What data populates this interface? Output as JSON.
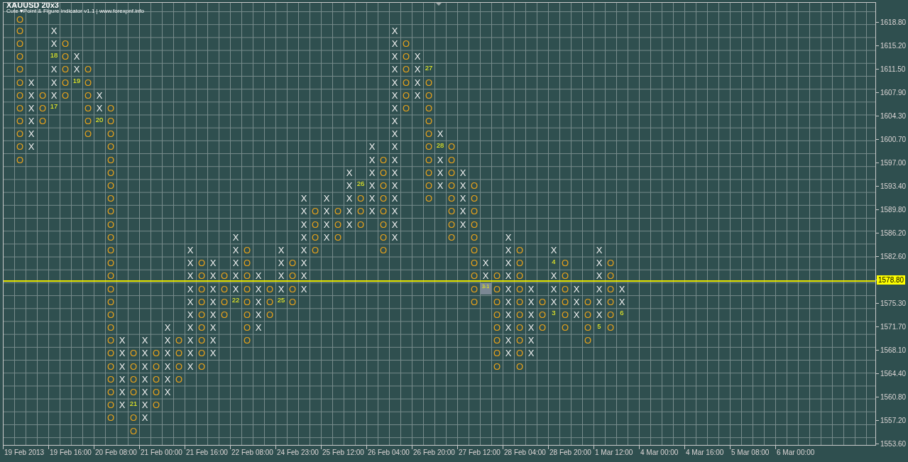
{
  "chart": {
    "title": "XAUUSD 20x3",
    "subtitle": "Cute ♥Point & Figure indicator v1.1 | www.forexpnf.info",
    "columns": [
      {
        "kind": "o",
        "cells": [
          "O",
          "O",
          "O",
          "O",
          "O",
          "O",
          "O",
          "O",
          "O",
          "O",
          "O",
          "O"
        ]
      },
      {
        "kind": "x",
        "cells": [
          null,
          null,
          null,
          null,
          null,
          "X",
          "X",
          "X",
          "X",
          "X",
          "X"
        ]
      },
      {
        "kind": "o",
        "cells": [
          null,
          null,
          null,
          null,
          null,
          null,
          "O",
          "O",
          "O"
        ]
      },
      {
        "kind": "x",
        "cells": [
          null,
          "X",
          "X",
          {
            "label": "18",
            "current": false
          },
          "X",
          "X",
          "X",
          {
            "label": "17",
            "current": false
          }
        ]
      },
      {
        "kind": "o",
        "cells": [
          null,
          null,
          "O",
          "O",
          "O",
          "O",
          "O"
        ]
      },
      {
        "kind": "x",
        "cells": [
          null,
          null,
          null,
          "X",
          "X",
          {
            "label": "19",
            "current": false
          }
        ]
      },
      {
        "kind": "o",
        "cells": [
          null,
          null,
          null,
          null,
          "O",
          "O",
          "O",
          "O",
          "O",
          "O"
        ]
      },
      {
        "kind": "x",
        "cells": [
          null,
          null,
          null,
          null,
          null,
          null,
          "X",
          "X",
          {
            "label": "20",
            "current": false
          }
        ]
      },
      {
        "kind": "o",
        "cells": [
          null,
          null,
          null,
          null,
          null,
          null,
          null,
          "O",
          "O",
          "O",
          "O",
          "O",
          "O",
          "O",
          "O",
          "O",
          "O",
          "O",
          "O",
          "O",
          "O",
          "O",
          "O",
          "O",
          "O",
          "O",
          "O",
          "O",
          "O",
          "O",
          "O",
          "O"
        ]
      },
      {
        "kind": "x",
        "cells": [
          null,
          null,
          null,
          null,
          null,
          null,
          null,
          null,
          null,
          null,
          null,
          null,
          null,
          null,
          null,
          null,
          null,
          null,
          null,
          null,
          null,
          null,
          null,
          null,
          null,
          "X",
          "X",
          "X",
          "X",
          "X",
          "X"
        ]
      },
      {
        "kind": "o",
        "cells": [
          null,
          null,
          null,
          null,
          null,
          null,
          null,
          null,
          null,
          null,
          null,
          null,
          null,
          null,
          null,
          null,
          null,
          null,
          null,
          null,
          null,
          null,
          null,
          null,
          null,
          null,
          "O",
          "O",
          "O",
          "O",
          {
            "label": "21",
            "current": false
          },
          "O",
          "O"
        ]
      },
      {
        "kind": "x",
        "cells": [
          null,
          null,
          null,
          null,
          null,
          null,
          null,
          null,
          null,
          null,
          null,
          null,
          null,
          null,
          null,
          null,
          null,
          null,
          null,
          null,
          null,
          null,
          null,
          null,
          null,
          "X",
          "X",
          "X",
          "X",
          "X",
          "X",
          "X"
        ]
      },
      {
        "kind": "o",
        "cells": [
          null,
          null,
          null,
          null,
          null,
          null,
          null,
          null,
          null,
          null,
          null,
          null,
          null,
          null,
          null,
          null,
          null,
          null,
          null,
          null,
          null,
          null,
          null,
          null,
          null,
          null,
          "O",
          "O",
          "O",
          "O",
          "O"
        ]
      },
      {
        "kind": "x",
        "cells": [
          null,
          null,
          null,
          null,
          null,
          null,
          null,
          null,
          null,
          null,
          null,
          null,
          null,
          null,
          null,
          null,
          null,
          null,
          null,
          null,
          null,
          null,
          null,
          null,
          "X",
          "X",
          "X",
          "X",
          "X",
          "X"
        ]
      },
      {
        "kind": "o",
        "cells": [
          null,
          null,
          null,
          null,
          null,
          null,
          null,
          null,
          null,
          null,
          null,
          null,
          null,
          null,
          null,
          null,
          null,
          null,
          null,
          null,
          null,
          null,
          null,
          null,
          null,
          "O",
          "O",
          "O",
          "O"
        ]
      },
      {
        "kind": "x",
        "cells": [
          null,
          null,
          null,
          null,
          null,
          null,
          null,
          null,
          null,
          null,
          null,
          null,
          null,
          null,
          null,
          null,
          null,
          null,
          "X",
          "X",
          "X",
          "X",
          "X",
          "X",
          "X",
          "X",
          "X",
          "X"
        ]
      },
      {
        "kind": "o",
        "cells": [
          null,
          null,
          null,
          null,
          null,
          null,
          null,
          null,
          null,
          null,
          null,
          null,
          null,
          null,
          null,
          null,
          null,
          null,
          null,
          "O",
          "O",
          "O",
          "O",
          "O",
          "O",
          "O",
          "O",
          "O"
        ]
      },
      {
        "kind": "x",
        "cells": [
          null,
          null,
          null,
          null,
          null,
          null,
          null,
          null,
          null,
          null,
          null,
          null,
          null,
          null,
          null,
          null,
          null,
          null,
          null,
          "X",
          "X",
          "X",
          "X",
          "X",
          "X",
          "X",
          "X"
        ]
      },
      {
        "kind": "o",
        "cells": [
          null,
          null,
          null,
          null,
          null,
          null,
          null,
          null,
          null,
          null,
          null,
          null,
          null,
          null,
          null,
          null,
          null,
          null,
          null,
          null,
          "O",
          "O",
          "O",
          "O"
        ]
      },
      {
        "kind": "x",
        "cells": [
          null,
          null,
          null,
          null,
          null,
          null,
          null,
          null,
          null,
          null,
          null,
          null,
          null,
          null,
          null,
          null,
          null,
          "X",
          "X",
          "X",
          "X",
          "X",
          {
            "label": "22",
            "current": false
          }
        ]
      },
      {
        "kind": "o",
        "cells": [
          null,
          null,
          null,
          null,
          null,
          null,
          null,
          null,
          null,
          null,
          null,
          null,
          null,
          null,
          null,
          null,
          null,
          null,
          "O",
          "O",
          "O",
          "O",
          "O",
          "O",
          "O",
          "O"
        ]
      },
      {
        "kind": "x",
        "cells": [
          null,
          null,
          null,
          null,
          null,
          null,
          null,
          null,
          null,
          null,
          null,
          null,
          null,
          null,
          null,
          null,
          null,
          null,
          null,
          null,
          "X",
          "X",
          "X",
          "X",
          "X"
        ]
      },
      {
        "kind": "o",
        "cells": [
          null,
          null,
          null,
          null,
          null,
          null,
          null,
          null,
          null,
          null,
          null,
          null,
          null,
          null,
          null,
          null,
          null,
          null,
          null,
          null,
          null,
          "O",
          "O",
          "O"
        ]
      },
      {
        "kind": "x",
        "cells": [
          null,
          null,
          null,
          null,
          null,
          null,
          null,
          null,
          null,
          null,
          null,
          null,
          null,
          null,
          null,
          null,
          null,
          null,
          "X",
          "X",
          "X",
          "X",
          {
            "label": "25",
            "current": false
          }
        ]
      },
      {
        "kind": "o",
        "cells": [
          null,
          null,
          null,
          null,
          null,
          null,
          null,
          null,
          null,
          null,
          null,
          null,
          null,
          null,
          null,
          null,
          null,
          null,
          null,
          "O",
          "O",
          "O",
          "O"
        ]
      },
      {
        "kind": "x",
        "cells": [
          null,
          null,
          null,
          null,
          null,
          null,
          null,
          null,
          null,
          null,
          null,
          null,
          null,
          null,
          "X",
          "X",
          "X",
          "X",
          "X",
          "X",
          "X",
          "X"
        ]
      },
      {
        "kind": "o",
        "cells": [
          null,
          null,
          null,
          null,
          null,
          null,
          null,
          null,
          null,
          null,
          null,
          null,
          null,
          null,
          null,
          "O",
          "O",
          "O",
          "O"
        ]
      },
      {
        "kind": "x",
        "cells": [
          null,
          null,
          null,
          null,
          null,
          null,
          null,
          null,
          null,
          null,
          null,
          null,
          null,
          null,
          "X",
          "X",
          "X",
          "X"
        ]
      },
      {
        "kind": "o",
        "cells": [
          null,
          null,
          null,
          null,
          null,
          null,
          null,
          null,
          null,
          null,
          null,
          null,
          null,
          null,
          null,
          "O",
          "O",
          "O"
        ]
      },
      {
        "kind": "x",
        "cells": [
          null,
          null,
          null,
          null,
          null,
          null,
          null,
          null,
          null,
          null,
          null,
          null,
          "X",
          "X",
          "X",
          "X",
          "X"
        ]
      },
      {
        "kind": "o",
        "cells": [
          null,
          null,
          null,
          null,
          null,
          null,
          null,
          null,
          null,
          null,
          null,
          null,
          null,
          {
            "label": "26",
            "current": false
          },
          "O",
          "O",
          "O"
        ]
      },
      {
        "kind": "x",
        "cells": [
          null,
          null,
          null,
          null,
          null,
          null,
          null,
          null,
          null,
          null,
          "X",
          "X",
          "X",
          "X",
          "X",
          "X"
        ]
      },
      {
        "kind": "o",
        "cells": [
          null,
          null,
          null,
          null,
          null,
          null,
          null,
          null,
          null,
          null,
          null,
          "O",
          "O",
          "O",
          "O",
          "O",
          "O",
          "O",
          "O"
        ]
      },
      {
        "kind": "x",
        "cells": [
          null,
          "X",
          "X",
          "X",
          "X",
          "X",
          "X",
          "X",
          "X",
          "X",
          "X",
          "X",
          "X",
          "X",
          "X",
          "X",
          "X",
          "X"
        ]
      },
      {
        "kind": "o",
        "cells": [
          null,
          null,
          "O",
          "O",
          "O",
          "O",
          "O",
          "O"
        ]
      },
      {
        "kind": "x",
        "cells": [
          null,
          null,
          null,
          "X",
          "X",
          "X",
          "X"
        ]
      },
      {
        "kind": "o",
        "cells": [
          null,
          null,
          null,
          null,
          {
            "label": "27",
            "current": false
          },
          "O",
          "O",
          "O",
          "O",
          "O",
          "O",
          "O",
          "O",
          "O",
          "O"
        ]
      },
      {
        "kind": "x",
        "cells": [
          null,
          null,
          null,
          null,
          null,
          null,
          null,
          null,
          null,
          "X",
          {
            "label": "28",
            "current": false
          },
          "X",
          "X",
          "X"
        ]
      },
      {
        "kind": "o",
        "cells": [
          null,
          null,
          null,
          null,
          null,
          null,
          null,
          null,
          null,
          null,
          "O",
          "O",
          "O",
          "O",
          "O",
          "O",
          "O",
          "O"
        ]
      },
      {
        "kind": "x",
        "cells": [
          null,
          null,
          null,
          null,
          null,
          null,
          null,
          null,
          null,
          null,
          null,
          null,
          "X",
          "X",
          "X",
          "X",
          "X"
        ]
      },
      {
        "kind": "o",
        "cells": [
          null,
          null,
          null,
          null,
          null,
          null,
          null,
          null,
          null,
          null,
          null,
          null,
          null,
          "O",
          "O",
          "O",
          "O",
          "O",
          "O",
          "O",
          "O",
          "O",
          "O"
        ]
      },
      {
        "kind": "x",
        "cells": [
          null,
          null,
          null,
          null,
          null,
          null,
          null,
          null,
          null,
          null,
          null,
          null,
          null,
          null,
          null,
          null,
          null,
          null,
          null,
          "X",
          "X",
          {
            "label": "3-1",
            "current": true
          }
        ]
      },
      {
        "kind": "o",
        "cells": [
          null,
          null,
          null,
          null,
          null,
          null,
          null,
          null,
          null,
          null,
          null,
          null,
          null,
          null,
          null,
          null,
          null,
          null,
          null,
          null,
          "O",
          "O",
          "O",
          "O",
          "O",
          "O",
          "O",
          "O"
        ]
      },
      {
        "kind": "x",
        "cells": [
          null,
          null,
          null,
          null,
          null,
          null,
          null,
          null,
          null,
          null,
          null,
          null,
          null,
          null,
          null,
          null,
          null,
          "X",
          "X",
          "X",
          "X",
          "X",
          "X",
          "X",
          "X",
          "X",
          "X"
        ]
      },
      {
        "kind": "o",
        "cells": [
          null,
          null,
          null,
          null,
          null,
          null,
          null,
          null,
          null,
          null,
          null,
          null,
          null,
          null,
          null,
          null,
          null,
          null,
          "O",
          "O",
          "O",
          "O",
          "O",
          "O",
          "O",
          "O",
          "O",
          "O"
        ]
      },
      {
        "kind": "x",
        "cells": [
          null,
          null,
          null,
          null,
          null,
          null,
          null,
          null,
          null,
          null,
          null,
          null,
          null,
          null,
          null,
          null,
          null,
          null,
          null,
          null,
          null,
          "X",
          "X",
          "X",
          "X",
          "X",
          "X"
        ]
      },
      {
        "kind": "o",
        "cells": [
          null,
          null,
          null,
          null,
          null,
          null,
          null,
          null,
          null,
          null,
          null,
          null,
          null,
          null,
          null,
          null,
          null,
          null,
          null,
          null,
          null,
          null,
          "O",
          "O",
          "O"
        ]
      },
      {
        "kind": "x",
        "cells": [
          null,
          null,
          null,
          null,
          null,
          null,
          null,
          null,
          null,
          null,
          null,
          null,
          null,
          null,
          null,
          null,
          null,
          null,
          "X",
          {
            "label": "4",
            "current": false
          },
          "X",
          "X",
          "X",
          {
            "label": "3",
            "current": false
          }
        ]
      },
      {
        "kind": "o",
        "cells": [
          null,
          null,
          null,
          null,
          null,
          null,
          null,
          null,
          null,
          null,
          null,
          null,
          null,
          null,
          null,
          null,
          null,
          null,
          null,
          "O",
          "O",
          "O",
          "O",
          "O",
          "O"
        ]
      },
      {
        "kind": "x",
        "cells": [
          null,
          null,
          null,
          null,
          null,
          null,
          null,
          null,
          null,
          null,
          null,
          null,
          null,
          null,
          null,
          null,
          null,
          null,
          null,
          null,
          null,
          "X",
          "X",
          "X"
        ]
      },
      {
        "kind": "o",
        "cells": [
          null,
          null,
          null,
          null,
          null,
          null,
          null,
          null,
          null,
          null,
          null,
          null,
          null,
          null,
          null,
          null,
          null,
          null,
          null,
          null,
          null,
          null,
          "O",
          "O",
          "O",
          "O"
        ]
      },
      {
        "kind": "x",
        "cells": [
          null,
          null,
          null,
          null,
          null,
          null,
          null,
          null,
          null,
          null,
          null,
          null,
          null,
          null,
          null,
          null,
          null,
          null,
          "X",
          "X",
          "X",
          "X",
          "X",
          "X",
          {
            "label": "5",
            "current": false
          }
        ]
      },
      {
        "kind": "o",
        "cells": [
          null,
          null,
          null,
          null,
          null,
          null,
          null,
          null,
          null,
          null,
          null,
          null,
          null,
          null,
          null,
          null,
          null,
          null,
          null,
          "O",
          "O",
          "O",
          "O",
          "O",
          "O"
        ]
      },
      {
        "kind": "x",
        "cells": [
          null,
          null,
          null,
          null,
          null,
          null,
          null,
          null,
          null,
          null,
          null,
          null,
          null,
          null,
          null,
          null,
          null,
          null,
          null,
          null,
          null,
          "X",
          "X",
          {
            "label": "6",
            "current": false
          }
        ]
      }
    ],
    "price_axis": [
      {
        "label": "1618.80",
        "current": false
      },
      {
        "label": "1615.20",
        "current": false
      },
      {
        "label": "1611.50",
        "current": false
      },
      {
        "label": "1607.90",
        "current": false
      },
      {
        "label": "1604.30",
        "current": false
      },
      {
        "label": "1600.70",
        "current": false
      },
      {
        "label": "1597.00",
        "current": false
      },
      {
        "label": "1593.40",
        "current": false
      },
      {
        "label": "1589.80",
        "current": false
      },
      {
        "label": "1586.20",
        "current": false
      },
      {
        "label": "1582.60",
        "current": false
      },
      {
        "label": "1578.80",
        "current": true
      },
      {
        "label": "1575.30",
        "current": false
      },
      {
        "label": "1571.70",
        "current": false
      },
      {
        "label": "1568.10",
        "current": false
      },
      {
        "label": "1564.40",
        "current": false
      },
      {
        "label": "1560.80",
        "current": false
      },
      {
        "label": "1557.20",
        "current": false
      },
      {
        "label": "1553.60",
        "current": false
      }
    ],
    "time_axis": [
      "19 Feb 2013",
      "19 Feb 16:00",
      "20 Feb 08:00",
      "21 Feb 00:00",
      "21 Feb 16:00",
      "22 Feb 08:00",
      "24 Feb 23:00",
      "25 Feb 12:00",
      "26 Feb 04:00",
      "26 Feb 20:00",
      "27 Feb 12:00",
      "28 Feb 04:00",
      "28 Feb 20:00",
      "1 Mar 12:00",
      "4 Mar 00:00",
      "4 Mar 16:00",
      "5 Mar 08:00",
      "6 Mar 00:00"
    ]
  }
}
